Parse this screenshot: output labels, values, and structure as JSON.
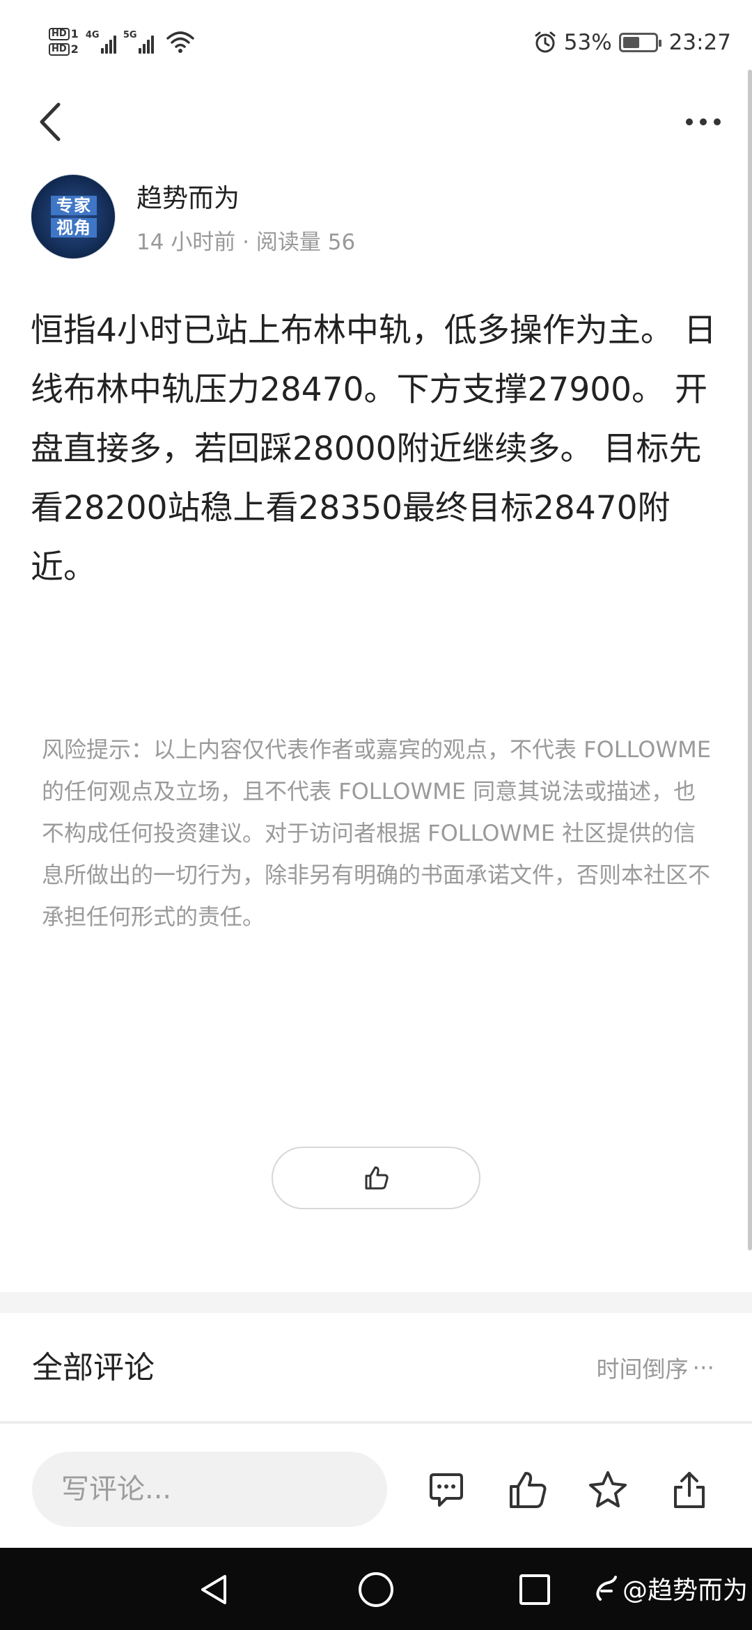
{
  "status_bar": {
    "hd1": "HD",
    "hd1_sub": "1",
    "hd2": "HD",
    "hd2_sub": "2",
    "net1": "4G",
    "net2": "5G",
    "battery_percent_text": "53%",
    "battery_level": 0.53,
    "time": "23:27"
  },
  "author": {
    "name": "趋势而为",
    "meta": "14 小时前 · 阅读量 56",
    "avatar_line1": "专家",
    "avatar_line2": "视角"
  },
  "article": {
    "body": "恒指4小时已站上布林中轨，低多操作为主。 日线布林中轨压力28470。下方支撑27900。 开盘直接多，若回踩28000附近继续多。 目标先看28200站稳上看28350最终目标28470附近。"
  },
  "disclaimer": {
    "text": "风险提示：以上内容仅代表作者或嘉宾的观点，不代表 FOLLOWME 的任何观点及立场，且不代表 FOLLOWME 同意其说法或描述，也不构成任何投资建议。对于访问者根据 FOLLOWME 社区提供的信息所做出的一切行为，除非另有明确的书面承诺文件，否则本社区不承担任何形式的责任。"
  },
  "comments": {
    "title": "全部评论",
    "sort_label": "时间倒序",
    "sort_more": "···"
  },
  "action_bar": {
    "placeholder": "写评论..."
  },
  "watermark": {
    "text": "@趋势而为"
  },
  "icons": {
    "back": "chevron-left-icon",
    "more": "more-dots-icon",
    "like": "thumbs-up-icon",
    "comment": "chat-bubble-icon",
    "star": "star-icon",
    "share": "share-icon"
  },
  "colors": {
    "text": "#222222",
    "muted": "#999999",
    "avatar_blue": "#3f76c6",
    "nav_bar": "#0b0b0b"
  }
}
